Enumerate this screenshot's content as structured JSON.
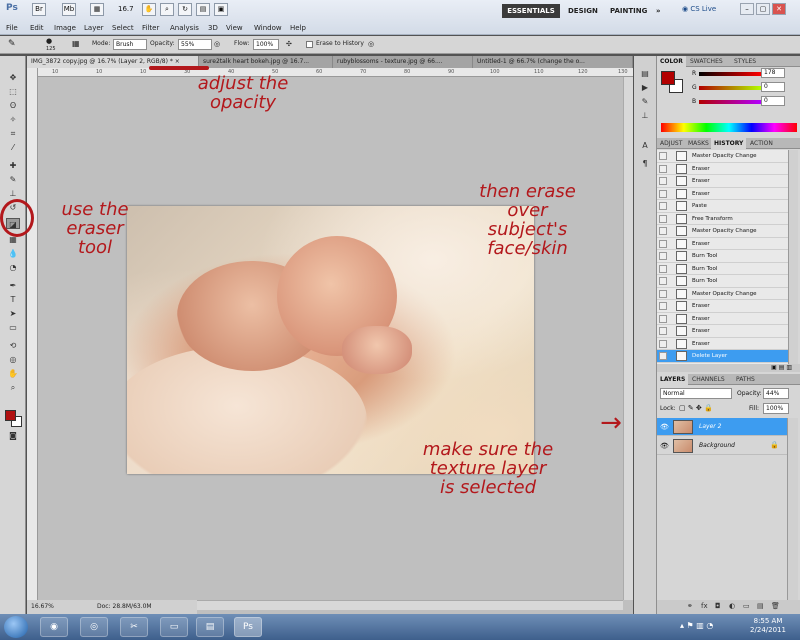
{
  "app": {
    "logo": "Ps",
    "zoom_value": "16.7",
    "br_chip": "Br",
    "mb_chip": "Mb",
    "workspaces": [
      "ESSENTIALS",
      "DESIGN",
      "PAINTING",
      "»"
    ],
    "cs_live": "CS Live",
    "window_controls": [
      "–",
      "▢",
      "✕"
    ]
  },
  "menu": [
    "File",
    "Edit",
    "Image",
    "Layer",
    "Select",
    "Filter",
    "Analysis",
    "3D",
    "View",
    "Window",
    "Help"
  ],
  "options": {
    "brush_size": "125",
    "mode_label": "Mode:",
    "mode_value": "Brush",
    "opacity_label": "Opacity:",
    "opacity_value": "55%",
    "flow_label": "Flow:",
    "flow_value": "100%",
    "erase_history": "Erase to History"
  },
  "document": {
    "tabs": [
      "IMG_3872 copy.jpg @ 16.7% (Layer 2, RGB/8) *  ×",
      "sure2talk heart bokeh.jpg @ 16.7...",
      "rubyblossoms - texture.jpg @ 66....",
      "Untitled-1 @ 66.7% (change the o..."
    ],
    "ruler_labels": [
      "10",
      "10",
      "10",
      "30",
      "40",
      "50",
      "60",
      "70",
      "80",
      "90",
      "100",
      "110",
      "120",
      "130"
    ],
    "status_zoom": "16.67%",
    "status_doc": "Doc: 28.8M/63.0M"
  },
  "annotations": {
    "opacity_note": "adjust the\nopacity",
    "eraser_note": "use the\neraser\ntool",
    "erase_note": "then erase\nover\nsubject's\nface/skin",
    "layer_note": "make sure the\ntexture layer\nis selected",
    "arrow": "→"
  },
  "color_panel": {
    "tabs": [
      "COLOR",
      "SWATCHES",
      "STYLES"
    ],
    "r_label": "R",
    "r_value": "178",
    "g_label": "G",
    "g_value": "0",
    "b_label": "B",
    "b_value": "0",
    "fg_color": "#b20000"
  },
  "history_panel": {
    "tabs": [
      "ADJUST",
      "MASKS",
      "HISTORY",
      "ACTION"
    ],
    "items": [
      "Master Opacity Change",
      "Eraser",
      "Eraser",
      "Eraser",
      "Paste",
      "Free Transform",
      "Master Opacity Change",
      "Eraser",
      "Burn Tool",
      "Burn Tool",
      "Burn Tool",
      "Master Opacity Change",
      "Eraser",
      "Eraser",
      "Eraser",
      "Eraser",
      "Delete Layer"
    ],
    "selected_index": 16
  },
  "layers_panel": {
    "tabs": [
      "LAYERS",
      "CHANNELS",
      "PATHS"
    ],
    "blend_mode": "Normal",
    "opacity_label": "Opacity:",
    "opacity_value": "44%",
    "lock_label": "Lock:",
    "fill_label": "Fill:",
    "fill_value": "100%",
    "layers": [
      {
        "name": "Layer 2",
        "selected": true
      },
      {
        "name": "Background",
        "selected": false
      }
    ],
    "footer_icons": [
      "⚭",
      "fx",
      "◘",
      "◐",
      "▭",
      "▤",
      "🗑"
    ]
  },
  "taskbar": {
    "time": "8:55 AM",
    "date": "2/24/2011"
  }
}
